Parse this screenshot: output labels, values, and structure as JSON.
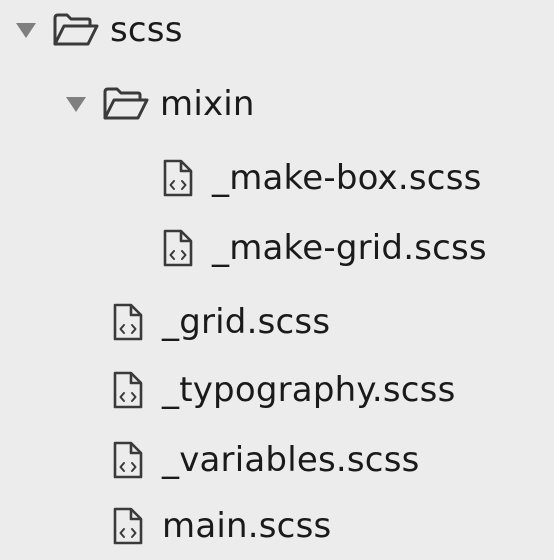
{
  "tree": {
    "root": {
      "label": "scss",
      "expanded": true,
      "icon": "folder-open-icon",
      "disclosure_icon": "triangle-down-icon",
      "children": {
        "mixin": {
          "label": "mixin",
          "expanded": true,
          "icon": "folder-open-icon",
          "disclosure_icon": "triangle-down-icon",
          "files": [
            {
              "label": "_make-box.scss",
              "icon": "code-file-icon"
            },
            {
              "label": "_make-grid.scss",
              "icon": "code-file-icon"
            }
          ]
        },
        "files": [
          {
            "label": "_grid.scss",
            "icon": "code-file-icon"
          },
          {
            "label": "_typography.scss",
            "icon": "code-file-icon"
          },
          {
            "label": "_variables.scss",
            "icon": "code-file-icon"
          },
          {
            "label": "main.scss",
            "icon": "code-file-icon"
          }
        ]
      }
    }
  },
  "colors": {
    "background": "#ececec",
    "text": "#1a1a1a",
    "disclosure": "#7f7f7f",
    "icon_stroke": "#3a3a3a"
  }
}
